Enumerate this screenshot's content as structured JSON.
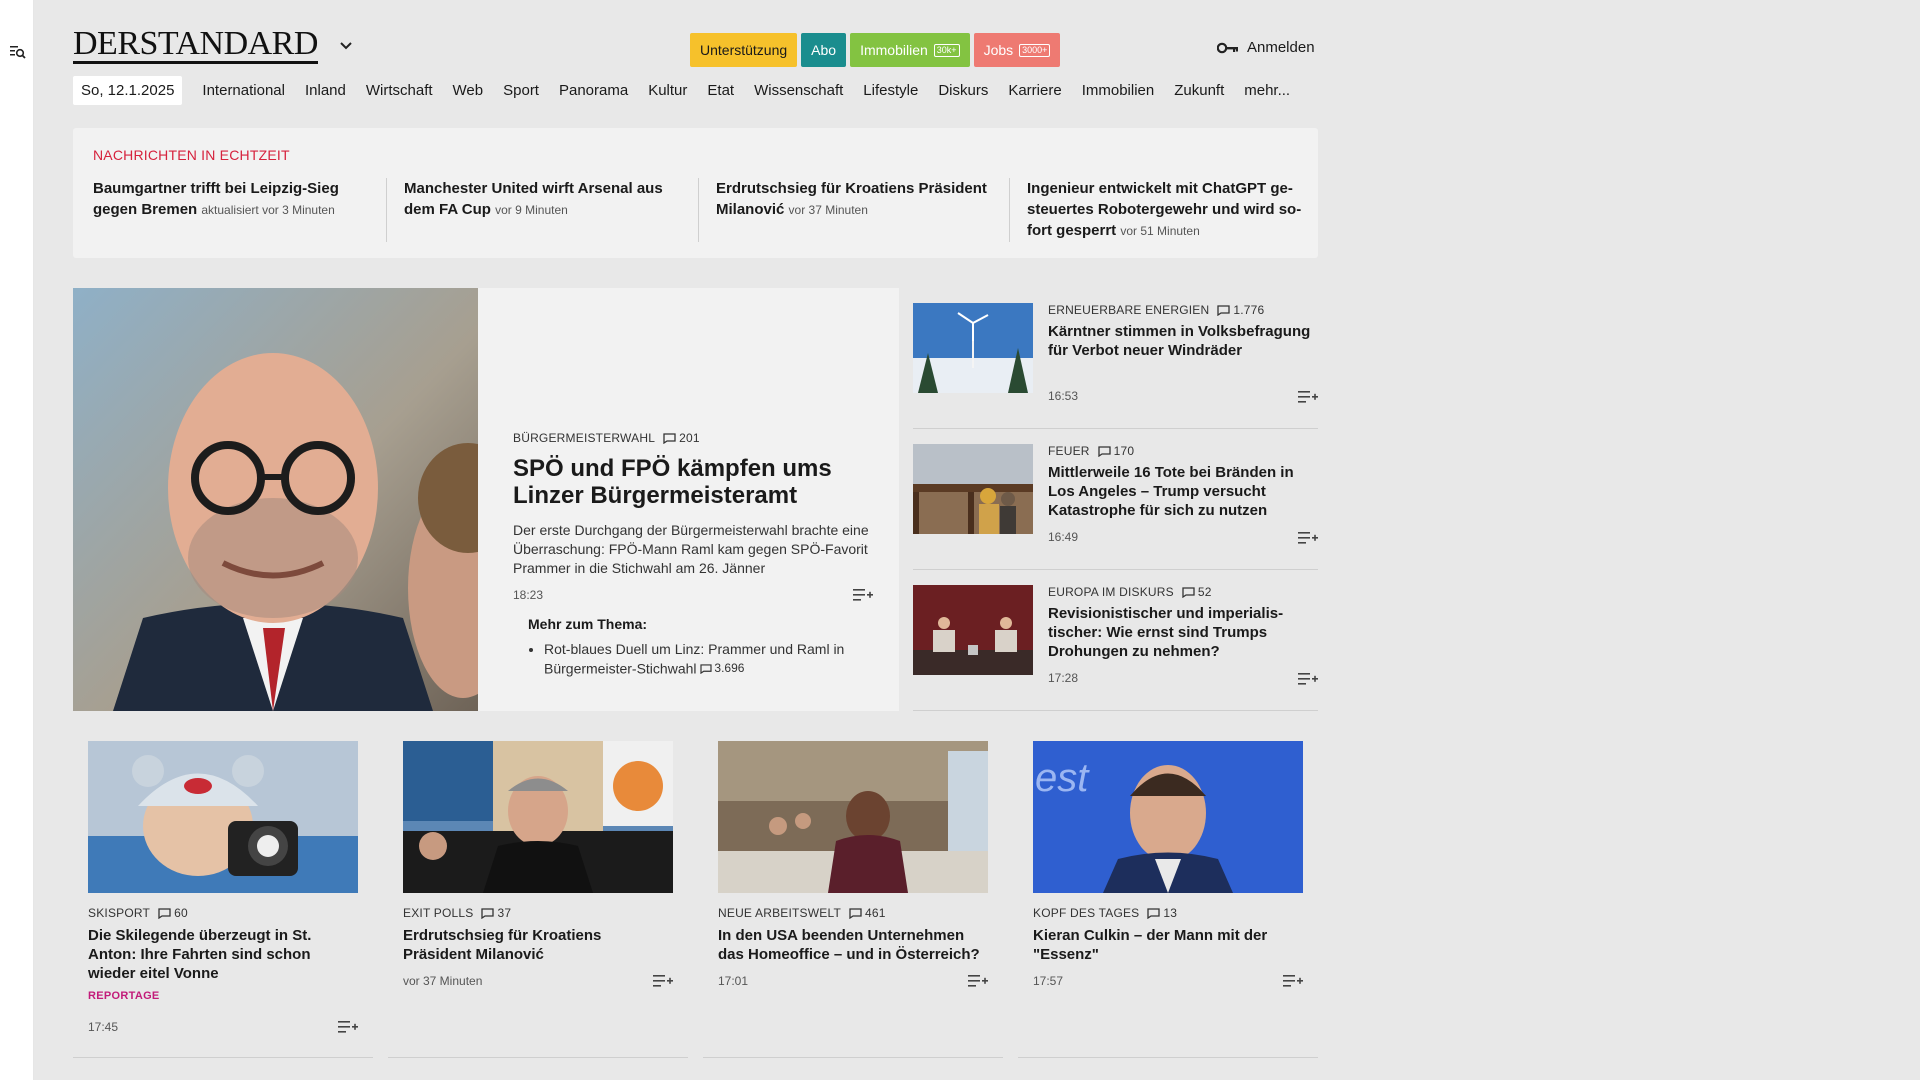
{
  "header": {
    "logo": "DERSTANDARD",
    "pills": [
      {
        "label": "Unterstützung",
        "badge": ""
      },
      {
        "label": "Abo",
        "badge": ""
      },
      {
        "label": "Immobilien",
        "badge": "30k+"
      },
      {
        "label": "Jobs",
        "badge": "3000+"
      }
    ],
    "login": "Anmelden"
  },
  "nav": {
    "date": "So, 12.1.2025",
    "items": [
      "International",
      "Inland",
      "Wirtschaft",
      "Web",
      "Sport",
      "Panorama",
      "Kultur",
      "Etat",
      "Wissenschaft",
      "Lifestyle",
      "Diskurs",
      "Karriere",
      "Immobilien",
      "Zukunft",
      "mehr..."
    ]
  },
  "ticker": {
    "label": "NACHRICHTEN IN ECHTZEIT",
    "items": [
      {
        "title": "Baumgartner trifft bei Leipzig-Sieg gegen Bremen",
        "meta": "aktualisiert vor 3 Minuten"
      },
      {
        "title": "Manchester United wirft Arsenal aus dem FA Cup",
        "meta": "vor 9 Minuten"
      },
      {
        "title": "Erdrutschsieg für Kroatiens Präsident Milanović",
        "meta": "vor 37 Minuten"
      },
      {
        "title": "Ingenieur entwickelt mit ChatGPT ge­steuertes Robotergewehr und wird so­fort gesperrt",
        "meta": "vor 51 Minuten"
      }
    ]
  },
  "hero": {
    "kicker": "BÜRGERMEISTERWAHL",
    "comments": "201",
    "title": "SPÖ und FPÖ kämpfen ums Linzer Bürgermeisteramt",
    "teaser": "Der erste Durchgang der Bürgermeisterwahl brachte eine Überraschung: FPÖ-Mann Raml kam gegen SPÖ-Favorit Prammer in die Stichwahl am 26. Jänner",
    "time": "18:23",
    "more_title": "Mehr zum Thema:",
    "more_item": "Rot-blaues Duell um Linz: Prammer und Raml in Bürgermeister-Stichwahl",
    "more_comments": "3.696"
  },
  "side_articles": [
    {
      "kicker": "ERNEUERBARE ENERGIEN",
      "comments": "1.776",
      "title": "Kärntner stimmen in Volksbefragung für Verbot neuer Windräder",
      "time": "16:53"
    },
    {
      "kicker": "FEUER",
      "comments": "170",
      "title": "Mittlerweile 16 Tote bei Bränden in Los Angeles – Trump versucht Katastrophe für sich zu nutzen",
      "time": "16:49"
    },
    {
      "kicker": "EUROPA IM DISKURS",
      "comments": "52",
      "title": "Revisionistischer und imperialis­tischer: Wie ernst sind Trumps Drohungen zu nehmen?",
      "time": "17:28"
    }
  ],
  "cards": [
    {
      "kicker": "SKISPORT",
      "comments": "60",
      "title": "Die Skilegende überzeugt in St. Anton: Ihre Fahrten sind schon wieder eitel Vonne",
      "label": "REPORTAGE",
      "time": "17:45"
    },
    {
      "kicker": "EXIT POLLS",
      "comments": "37",
      "title": "Erdrutschsieg für Kroatiens Präsident Milanović",
      "label": "",
      "time": "vor 37 Minuten"
    },
    {
      "kicker": "NEUE ARBEITSWELT",
      "comments": "461",
      "title": "In den USA beenden Unternehmen das Homeoffice – und in Österreich?",
      "label": "",
      "time": "17:01"
    },
    {
      "kicker": "KOPF DES TAGES",
      "comments": "13",
      "title": "Kieran Culkin – der Mann mit der \"Essenz\"",
      "label": "",
      "time": "17:57"
    }
  ]
}
